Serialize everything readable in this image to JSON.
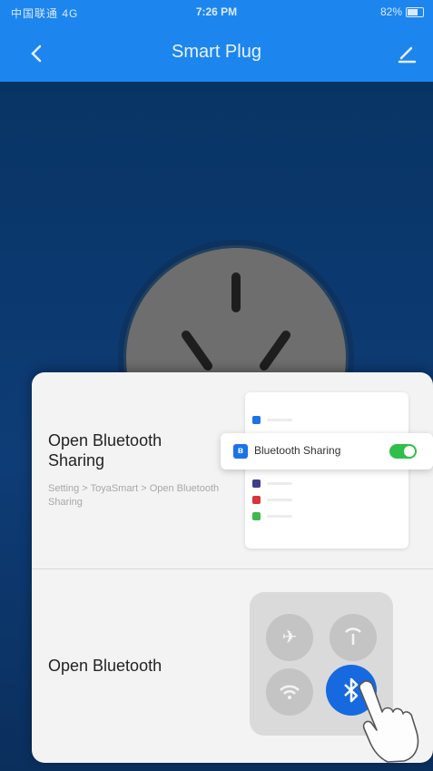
{
  "status_bar": {
    "carrier": "中国联通 4G",
    "time": "7:26 PM",
    "battery": "82%"
  },
  "nav": {
    "back_icon": "chevron-left-icon",
    "title": "Smart Plug",
    "edit_icon": "pencil-icon"
  },
  "sheet": {
    "step1": {
      "title": "Open Bluetooth Sharing",
      "subtitle": "Setting > ToyaSmart > Open Bluetooth Sharing",
      "row_label": "Bluetooth Sharing",
      "toggle_on": true
    },
    "step2": {
      "title": "Open Bluetooth"
    }
  },
  "colors": {
    "accent": "#1c86ee",
    "background": "#0b2d5e",
    "toggle": "#2fbf4a",
    "bluetooth": "#1769e0"
  }
}
